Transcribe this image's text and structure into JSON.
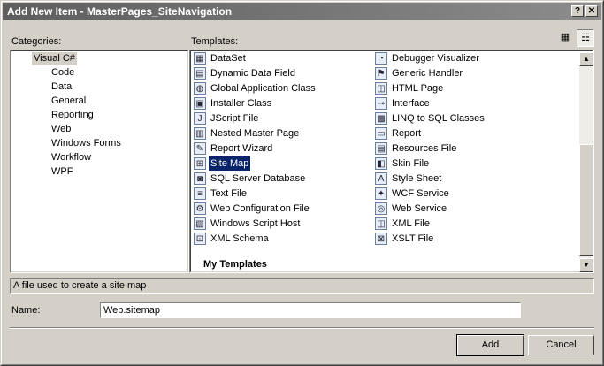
{
  "window": {
    "title": "Add New Item - MasterPages_SiteNavigation",
    "help_label": "?",
    "close_label": "✕"
  },
  "categories": {
    "label": "Categories:",
    "items": [
      {
        "label": "Visual C#",
        "selected": true
      },
      {
        "label": "Code"
      },
      {
        "label": "Data"
      },
      {
        "label": "General"
      },
      {
        "label": "Reporting"
      },
      {
        "label": "Web"
      },
      {
        "label": "Windows Forms"
      },
      {
        "label": "Workflow"
      },
      {
        "label": "WPF"
      }
    ]
  },
  "templates": {
    "label": "Templates:",
    "view_buttons": {
      "large_icons": "large-icons-view-icon",
      "small_icons": "small-icons-view-icon"
    },
    "left_column": [
      {
        "label": "DataSet",
        "icon": "dataset-icon",
        "glyph": "▦"
      },
      {
        "label": "Dynamic Data Field",
        "icon": "dynamic-data-field-icon",
        "glyph": "▤"
      },
      {
        "label": "Global Application Class",
        "icon": "global-application-class-icon",
        "glyph": "◍"
      },
      {
        "label": "Installer Class",
        "icon": "installer-class-icon",
        "glyph": "▣"
      },
      {
        "label": "JScript File",
        "icon": "jscript-file-icon",
        "glyph": "J"
      },
      {
        "label": "Nested Master Page",
        "icon": "nested-master-page-icon",
        "glyph": "▥"
      },
      {
        "label": "Report Wizard",
        "icon": "report-wizard-icon",
        "glyph": "✎"
      },
      {
        "label": "Site Map",
        "icon": "site-map-icon",
        "glyph": "⊞",
        "selected": true
      },
      {
        "label": "SQL Server Database",
        "icon": "sql-server-database-icon",
        "glyph": "◙"
      },
      {
        "label": "Text File",
        "icon": "text-file-icon",
        "glyph": "≡"
      },
      {
        "label": "Web Configuration File",
        "icon": "web-configuration-file-icon",
        "glyph": "⚙"
      },
      {
        "label": "Windows Script Host",
        "icon": "windows-script-host-icon",
        "glyph": "▧"
      },
      {
        "label": "XML Schema",
        "icon": "xml-schema-icon",
        "glyph": "⊡"
      }
    ],
    "right_column": [
      {
        "label": "Debugger Visualizer",
        "icon": "debugger-visualizer-icon",
        "glyph": "◔"
      },
      {
        "label": "Generic Handler",
        "icon": "generic-handler-icon",
        "glyph": "⚑"
      },
      {
        "label": "HTML Page",
        "icon": "html-page-icon",
        "glyph": "◫"
      },
      {
        "label": "Interface",
        "icon": "interface-icon",
        "glyph": "⊸"
      },
      {
        "label": "LINQ to SQL Classes",
        "icon": "linq-to-sql-classes-icon",
        "glyph": "▩"
      },
      {
        "label": "Report",
        "icon": "report-icon",
        "glyph": "▭"
      },
      {
        "label": "Resources File",
        "icon": "resources-file-icon",
        "glyph": "▤"
      },
      {
        "label": "Skin File",
        "icon": "skin-file-icon",
        "glyph": "◧"
      },
      {
        "label": "Style Sheet",
        "icon": "style-sheet-icon",
        "glyph": "A"
      },
      {
        "label": "WCF Service",
        "icon": "wcf-service-icon",
        "glyph": "✦"
      },
      {
        "label": "Web Service",
        "icon": "web-service-icon",
        "glyph": "◎"
      },
      {
        "label": "XML File",
        "icon": "xml-file-icon",
        "glyph": "◫"
      },
      {
        "label": "XSLT File",
        "icon": "xslt-file-icon",
        "glyph": "⊠"
      }
    ],
    "my_templates_label": "My Templates"
  },
  "description": "A file used to create a site map",
  "name_field": {
    "label": "Name:",
    "value": "Web.sitemap"
  },
  "buttons": {
    "add": "Add",
    "cancel": "Cancel"
  }
}
